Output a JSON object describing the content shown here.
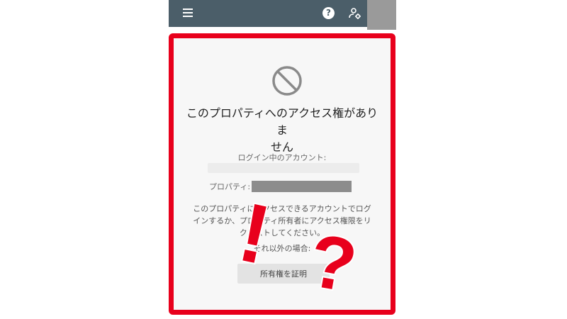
{
  "toolbar": {
    "menu_icon": "menu-icon",
    "help_icon": "help-icon",
    "help_glyph": "?",
    "account_icon": "manage-account-icon"
  },
  "dialog": {
    "icon": "no-entry-icon",
    "title_line1": "このプロパティへのアクセス権がありま",
    "title_line2": "せん",
    "account_label": "ログイン中のアカウント:",
    "property_label": "プロパティ:",
    "body_line1": "このプロパティにアクセスできるアカウントでログ",
    "body_line2": "インするか、プロパティ所有者にアクセス権限をリ",
    "body_line3": "クエストしてください。",
    "other_label": "それ以外の場合:",
    "prove_button": "所有権を証明"
  },
  "overlay": {
    "exclamation": "!",
    "question": "?"
  },
  "colors": {
    "topbar": "#4b5e69",
    "highlight_red": "#e8001c",
    "background": "#f7f7f7"
  }
}
